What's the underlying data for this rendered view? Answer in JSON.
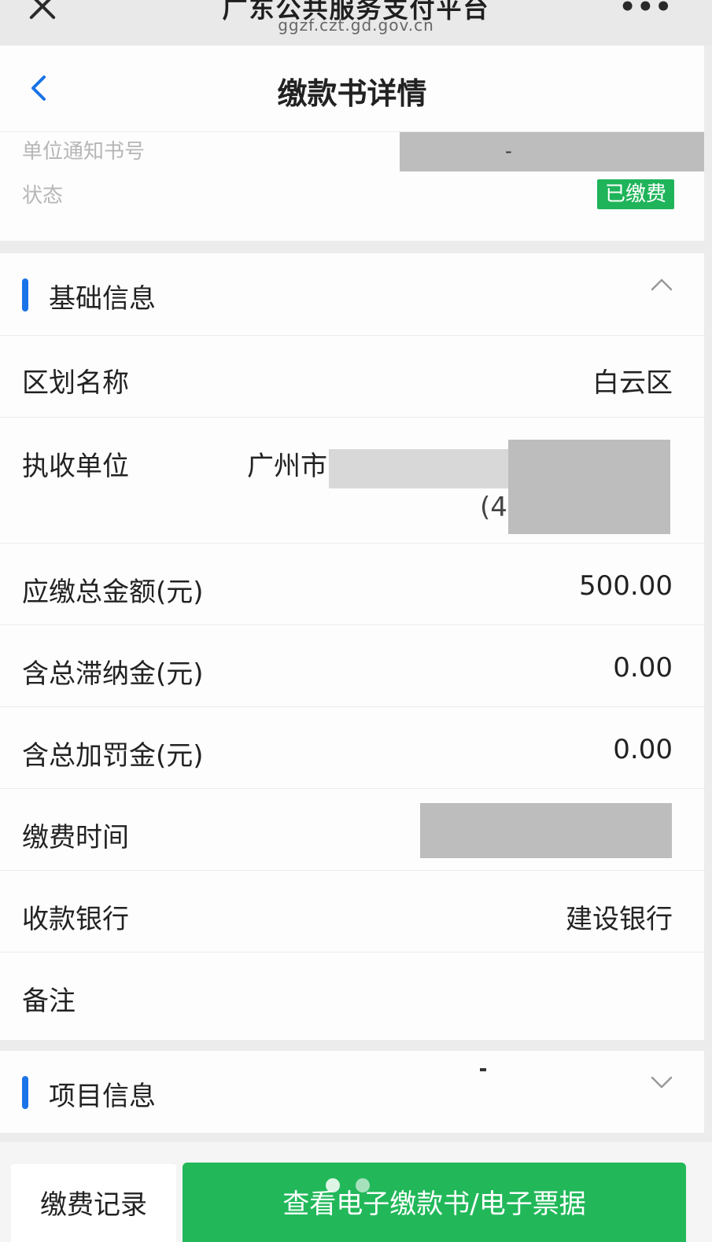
{
  "browser": {
    "title": "广东公共服务支付平台",
    "url": "ggzf.czt.gd.gov.cn",
    "more_icon": "more-dots-icon",
    "close_icon": "close-icon"
  },
  "header": {
    "title": "缴款书详情",
    "back_icon": "chevron-left-icon"
  },
  "summary": {
    "notice_no_label": "单位通知书号",
    "notice_no_value": "-",
    "status_label": "状态",
    "status_value": "已缴费"
  },
  "basic_info": {
    "section_title": "基础信息",
    "rows": [
      {
        "label": "区划名称",
        "value": "白云区"
      },
      {
        "label": "执收单位",
        "value": "广州市",
        "sub_value": "(4"
      },
      {
        "label": "应缴总金额(元)",
        "value": "500.00"
      },
      {
        "label": "含总滞纳金(元)",
        "value": "0.00"
      },
      {
        "label": "含总加罚金(元)",
        "value": "0.00"
      },
      {
        "label": "缴费时间",
        "value": ""
      },
      {
        "label": "收款银行",
        "value": "建设银行"
      },
      {
        "label": "备注",
        "value": ""
      }
    ]
  },
  "project_info": {
    "section_title": "项目信息",
    "dash": "-"
  },
  "actions": {
    "records_label": "缴费记录",
    "view_label": "查看电子缴款书/电子票据"
  },
  "colors": {
    "accent_blue": "#1a73e8",
    "success_green": "#1fb45a",
    "button_green": "#22b85a",
    "redaction_gray": "#bdbdbd"
  }
}
